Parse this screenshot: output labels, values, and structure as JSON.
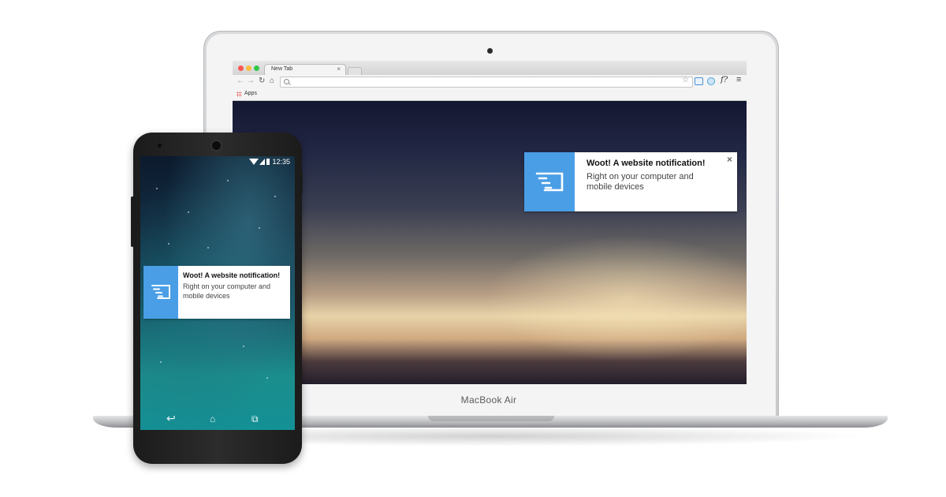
{
  "laptop": {
    "brand_label": "MacBook Air",
    "browser": {
      "tab_title": "New Tab",
      "tab_close": "×",
      "bookmarks_apps_label": "Apps",
      "omnibox_value": "",
      "menu_icon": "≡",
      "extension_f_label": "f?"
    },
    "notification": {
      "title": "Woot! A website notification!",
      "body": "Right on your computer and mobile devices",
      "close_label": "×",
      "icon": "send-notification-icon",
      "accent_color": "#4a9ee6"
    }
  },
  "phone": {
    "status_time": "12:35",
    "notification": {
      "title": "Woot! A website notification!",
      "body": "Right on your computer and mobile devices",
      "icon": "send-notification-icon",
      "accent_color": "#4a9ee6"
    },
    "nav": {
      "back_icon": "back-arrow-icon",
      "home_icon": "home-icon",
      "recents_icon": "recents-icon"
    }
  }
}
